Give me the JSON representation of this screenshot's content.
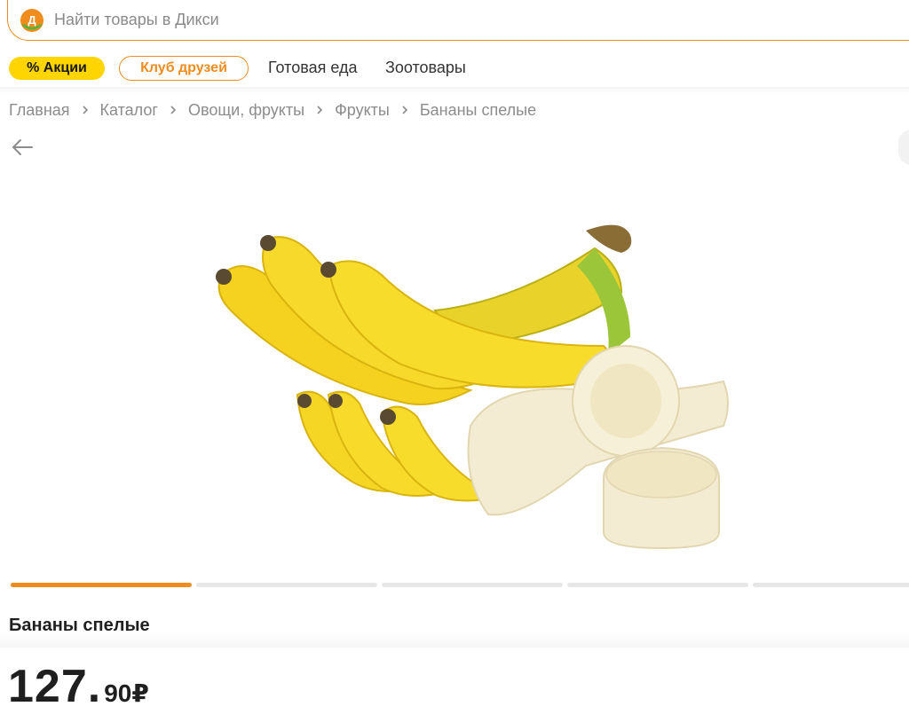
{
  "search": {
    "placeholder": "Найти товары в Дикси",
    "logo_letter": "Д"
  },
  "nav": {
    "promo_label": "% Акции",
    "club_label": "Клуб друзей",
    "links": [
      "Готовая еда",
      "Зоотовары"
    ]
  },
  "breadcrumb": [
    "Главная",
    "Каталог",
    "Овощи, фрукты",
    "Фрукты",
    "Бананы спелые"
  ],
  "gallery": {
    "slides_total": 5,
    "active_slide": 1,
    "image_alt_icon": "bananas-photo"
  },
  "product": {
    "title": "Бананы спелые",
    "price_int": "127",
    "price_dot": ".",
    "price_frac": "90",
    "currency": "₽"
  },
  "colors": {
    "accent_orange": "#f08c1e",
    "promo_yellow": "#ffd500",
    "logo_green": "#5bb33a"
  }
}
